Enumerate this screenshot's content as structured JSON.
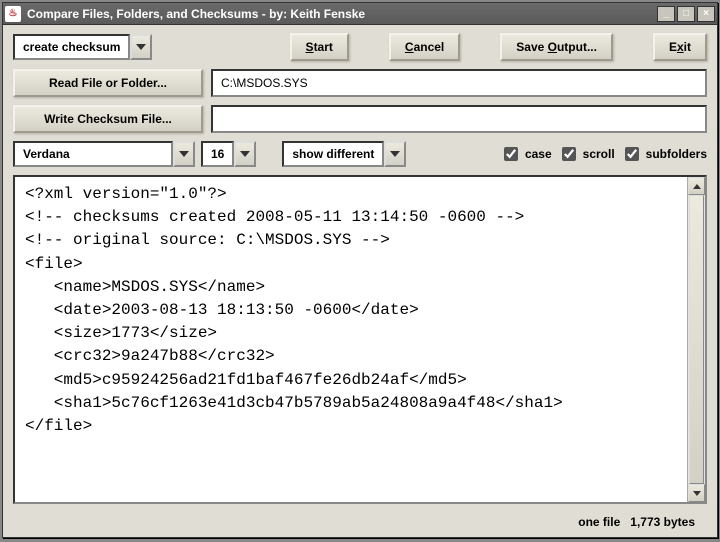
{
  "window": {
    "title": "Compare Files, Folders, and Checksums - by: Keith Fenske",
    "icon_letter": "♨"
  },
  "toolbar": {
    "action": "create checksum",
    "start": "Start",
    "cancel": "Cancel",
    "save_output": "Save Output...",
    "exit": "Exit"
  },
  "io": {
    "read_btn": "Read File or Folder...",
    "read_value": "C:\\MSDOS.SYS",
    "write_btn": "Write Checksum File...",
    "write_value": ""
  },
  "options": {
    "font": "Verdana",
    "size": "16",
    "show_mode": "show different",
    "case_label": "case",
    "scroll_label": "scroll",
    "subfolders_label": "subfolders",
    "case": true,
    "scroll": true,
    "subfolders": true
  },
  "output_lines": [
    "<?xml version=\"1.0\"?>",
    "<!-- checksums created 2008-05-11 13:14:50 -0600 -->",
    "<!-- original source: C:\\MSDOS.SYS -->",
    "<file>",
    "   <name>MSDOS.SYS</name>",
    "   <date>2003-08-13 18:13:50 -0600</date>",
    "   <size>1773</size>",
    "   <crc32>9a247b88</crc32>",
    "   <md5>c95924256ad21fd1baf467fe26db24af</md5>",
    "   <sha1>5c76cf1263e41d3cb47b5789ab5a24808a9a4f48</sha1>",
    "</file>"
  ],
  "status": {
    "summary": "one file",
    "bytes": "1,773 bytes"
  }
}
